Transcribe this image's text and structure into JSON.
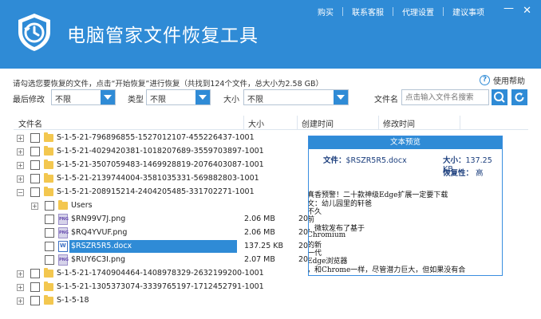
{
  "app": {
    "title": "电脑管家文件恢复工具",
    "top_links": [
      "购买",
      "联系客服",
      "代理设置",
      "建议事项"
    ],
    "minimize": "—",
    "close": "✕"
  },
  "info": {
    "text": "请勾选您要恢复的文件，点击“开始恢复”进行恢复（共找到124个文件，总大小为2.58 GB）",
    "help_label": "使用帮助",
    "help_icon_glyph": "?"
  },
  "filters": {
    "last_modified_label": "最后修改",
    "last_modified_value": "不限",
    "type_label": "类型",
    "type_value": "不限",
    "size_label": "大小",
    "size_value": "不限",
    "filename_label": "文件名",
    "search_placeholder": "点击输入文件名搜索"
  },
  "table": {
    "headers": [
      "文件名",
      "大小",
      "创建时间",
      "修改时间"
    ],
    "rows": [
      {
        "name": "S-1-5-21-796896855-1527012107-455226437-1001",
        "type": "folder",
        "size": "",
        "date": ""
      },
      {
        "name": "S-1-5-21-4029420381-1018207689-3559703897-1001",
        "type": "folder",
        "size": "",
        "date": ""
      },
      {
        "name": "S-1-5-21-3507059483-1469928819-2076403087-1001",
        "type": "folder",
        "size": "",
        "date": ""
      },
      {
        "name": "S-1-5-21-2139744004-3581035331-569882803-1001",
        "type": "folder",
        "size": "",
        "date": ""
      },
      {
        "name": "S-1-5-21-208915214-2404205485-331702271-1001",
        "type": "folder",
        "size": "",
        "date": ""
      },
      {
        "name": "Users",
        "type": "folder",
        "size": "",
        "date": ""
      },
      {
        "name": "$RN99V7J.png",
        "type": "png",
        "size": "2.06 MB",
        "date": "20"
      },
      {
        "name": "$RQ4YVUF.png",
        "type": "png",
        "size": "2.06 MB",
        "date": "20"
      },
      {
        "name": "$RSZR5R5.docx",
        "type": "docx",
        "size": "137.25 KB",
        "date": "20"
      },
      {
        "name": "$RUY6C3I.png",
        "type": "png",
        "size": "2.07 MB",
        "date": "20"
      },
      {
        "name": "S-1-5-21-1740904464-1408978329-2632199200-1001",
        "type": "folder",
        "size": "",
        "date": ""
      },
      {
        "name": "S-1-5-21-1305373074-3339765197-1712452791-1001",
        "type": "folder",
        "size": "",
        "date": ""
      },
      {
        "name": "S-1-5-18",
        "type": "folder",
        "size": "",
        "date": ""
      }
    ]
  },
  "preview": {
    "title": "文本预览",
    "filename_label": "文件：",
    "filename_value": "$RSZR5R5.docx",
    "size_label": "大小：",
    "size_value": "137.25 KB",
    "recoverability_label": "恢复性：",
    "recoverability_value": "高",
    "text_lines": [
      "真香预警！二十款神级Edge扩展一定要下载",
      "文：幼儿园里的轩爸",
      "不久",
      "前",
      "，微软发布了基于",
      "Chromium",
      "的新",
      "一代",
      "Edge浏览器",
      "，和Chrome一样，尽管潜力巨大，但如果没有合"
    ]
  },
  "colors": {
    "accent": "#2f8bd6",
    "selected_row": "#2f8bd6",
    "folder": "#f3c74f"
  }
}
